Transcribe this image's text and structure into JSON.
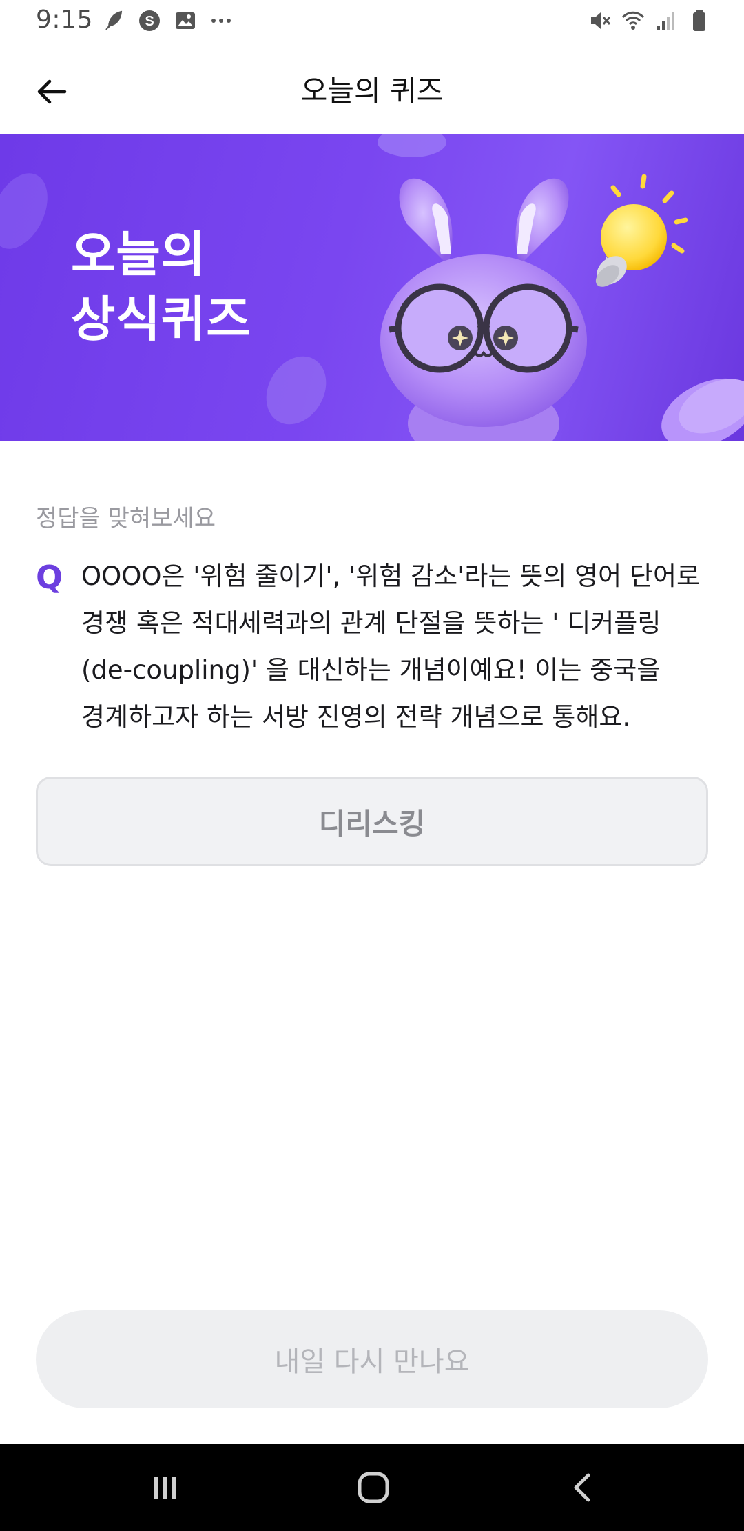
{
  "status_bar": {
    "time": "9:15",
    "left_icons": [
      "feather-icon",
      "s-circle-icon",
      "gallery-icon",
      "more-dots-icon"
    ],
    "right_icons": [
      "mute-icon",
      "wifi-icon",
      "signal-icon",
      "battery-icon"
    ]
  },
  "header": {
    "title": "오늘의 퀴즈",
    "back_icon": "arrow-left-icon"
  },
  "banner": {
    "title_line1": "오늘의",
    "title_line2": "상식퀴즈",
    "background_color": "#7a46f0"
  },
  "quiz": {
    "prompt": "정답을 맞혀보세요",
    "q_label": "Q",
    "question": "OOOO은 '위험 줄이기', '위험 감소'라는 뜻의 영어 단어로 경쟁 혹은 적대세력과의 관계 단절을 뜻하는 ' 디커플링 (de-coupling)' 을 대신하는 개념이예요! 이는 중국을 경계하고자 하는 서방 진영의 전략 개념으로 통해요.",
    "answer": "디리스킹"
  },
  "cta": {
    "label": "내일 다시 만나요"
  },
  "colors": {
    "accent": "#6c3fdf",
    "answer_bg": "#f1f2f4",
    "cta_bg": "#eeeff1"
  },
  "nav_bar": {
    "icons": [
      "recent-apps-icon",
      "home-icon",
      "back-chevron-icon"
    ]
  }
}
